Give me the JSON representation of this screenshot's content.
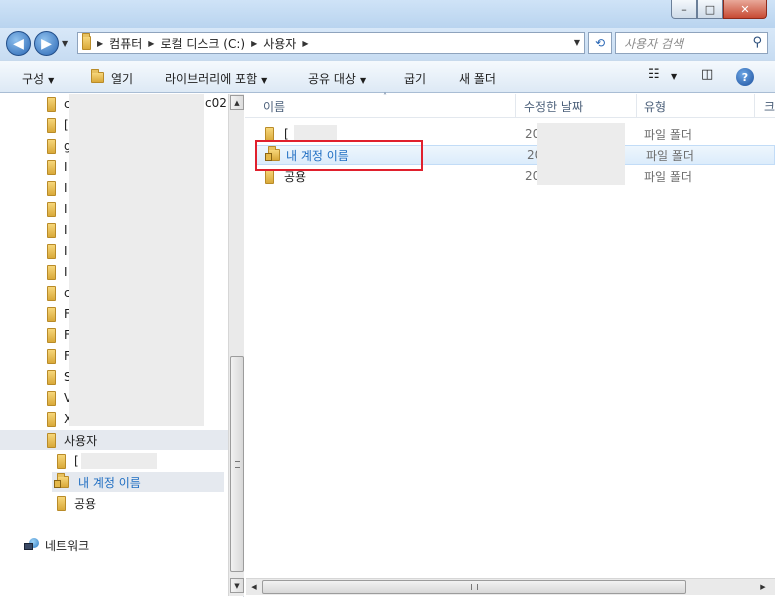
{
  "window": {
    "minimize_glyph": "–",
    "maximize_glyph": "□",
    "close_glyph": "✕"
  },
  "address": {
    "segments": [
      "컴퓨터",
      "로컬 디스크 (C:)",
      "사용자"
    ],
    "search_placeholder": "사용자 검색"
  },
  "toolbar": {
    "organize": "구성",
    "open": "열기",
    "include_library": "라이브러리에 포함",
    "share_with": "공유 대상",
    "burn": "굽기",
    "new_folder": "새 폴더",
    "help": "?"
  },
  "navpane": {
    "truncated_tail": "c02",
    "users_folder": "사용자",
    "user_children": [
      {
        "label": "[",
        "locked": false,
        "redacted": true
      },
      {
        "label": "내 계정 이름",
        "locked": true,
        "redacted": false
      },
      {
        "label": "공용",
        "locked": false,
        "redacted": false
      }
    ],
    "network": "네트워크",
    "top_folder_initials": [
      "c",
      "[",
      "g",
      "I",
      "I",
      "I",
      "I",
      "I",
      "I",
      "c",
      "F",
      "F",
      "F",
      "S",
      "V",
      "X"
    ]
  },
  "columns": {
    "name": "이름",
    "modified": "수정한 날짜",
    "type": "유형",
    "extra": "크"
  },
  "files": [
    {
      "name": "[",
      "date": "20",
      "type": "파일 폴더",
      "locked": false,
      "selected": false
    },
    {
      "name": "내 계정 이름",
      "date": "20",
      "type": "파일 폴더",
      "locked": true,
      "selected": true
    },
    {
      "name": "공용",
      "date": "20",
      "type": "파일 폴더",
      "locked": false,
      "selected": false
    }
  ],
  "colors": {
    "highlight_box": "#e0202d",
    "selected_text": "#1f6ec2"
  }
}
